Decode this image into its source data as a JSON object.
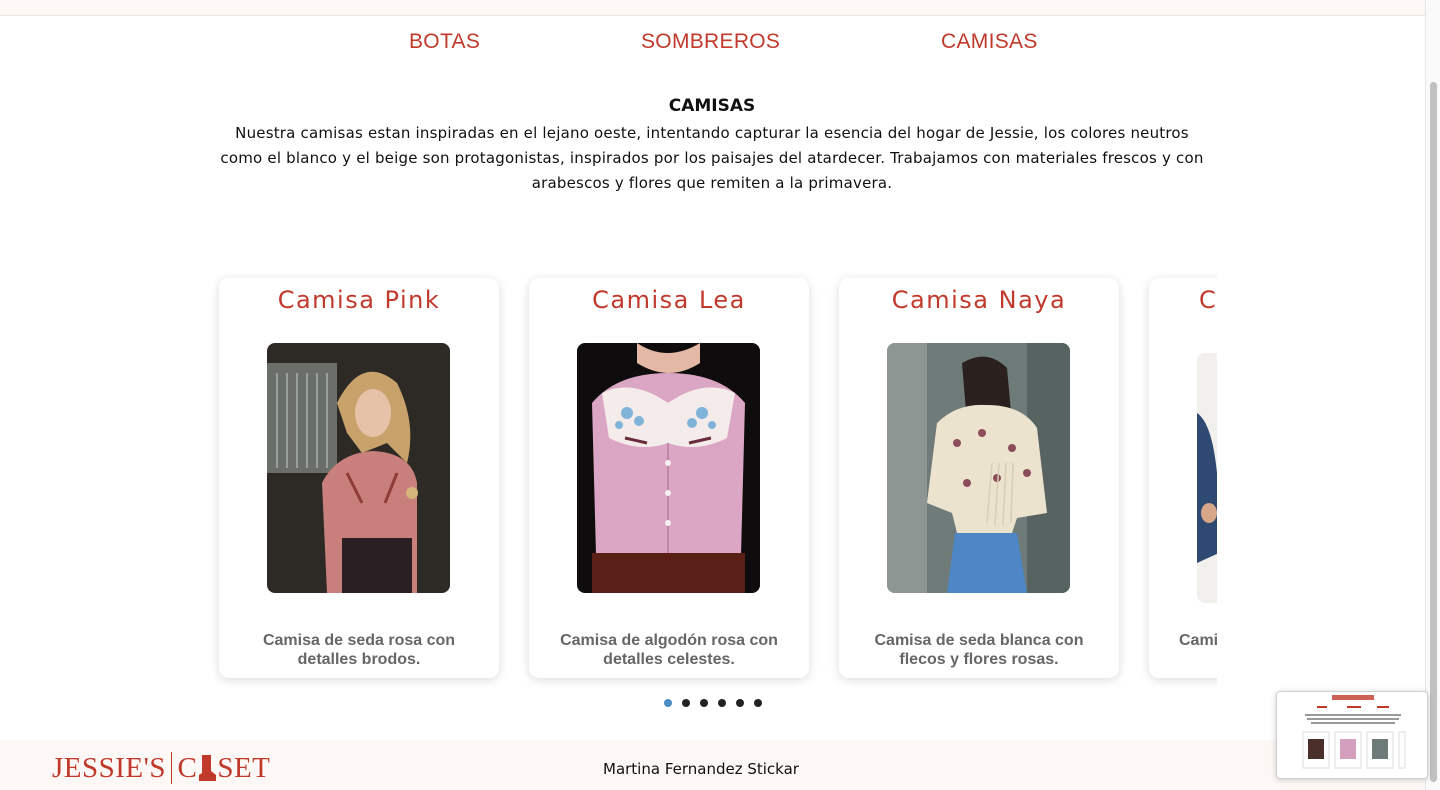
{
  "nav": {
    "items": [
      {
        "label": "BOTAS"
      },
      {
        "label": "SOMBREROS"
      },
      {
        "label": "CAMISAS"
      }
    ]
  },
  "intro": {
    "title": "CAMISAS",
    "text": "Nuestra camisas estan inspiradas en el lejano oeste, intentando capturar la esencia del hogar de Jessie, los colores neutros como el blanco y el beige son protagonistas, inspirados por los paisajes del atardecer. Trabajamos con materiales frescos y con arabescos y flores que remiten a la primavera."
  },
  "products": [
    {
      "title": "Camisa Pink",
      "description": "Camisa de seda rosa con detalles brodos."
    },
    {
      "title": "Camisa Lea",
      "description": "Camisa de algodón rosa con detalles celestes."
    },
    {
      "title": "Camisa Naya",
      "description": "Camisa de seda blanca con flecos y flores rosas."
    },
    {
      "title": "C",
      "description": "Cami"
    }
  ],
  "carousel": {
    "dot_count": 6,
    "active_index": 0
  },
  "footer": {
    "logo_left": "JESSIE'S",
    "logo_right_c": "C",
    "logo_right_rest": "SET",
    "credit": "Martina Fernandez Stickar"
  },
  "colors": {
    "accent": "#c0392b",
    "dot_active": "#4a8ec2",
    "footer_bg": "#fdf8f5"
  }
}
